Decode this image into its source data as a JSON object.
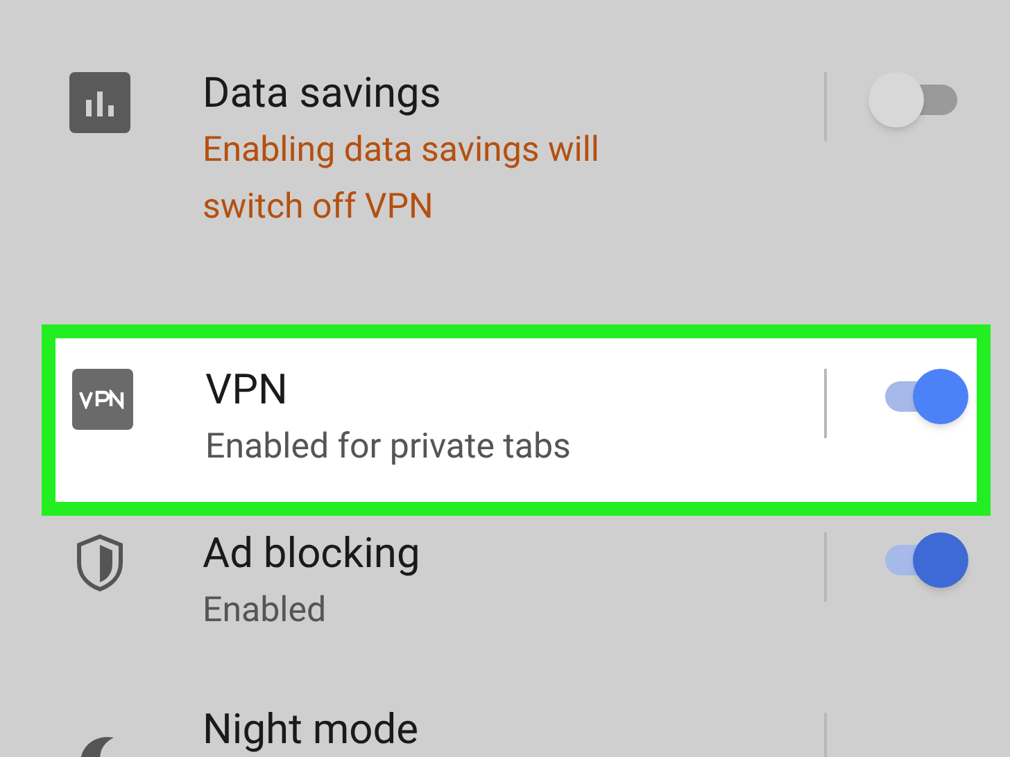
{
  "settings": [
    {
      "title": "Data savings",
      "subtitle": "Enabling data savings will switch off VPN",
      "warning": true,
      "highlighted": false,
      "on": false
    },
    {
      "title": "VPN",
      "subtitle": "Enabled for private tabs",
      "warning": false,
      "highlighted": true,
      "on": true
    },
    {
      "title": "Ad blocking",
      "subtitle": "Enabled",
      "warning": false,
      "highlighted": false,
      "on": true
    },
    {
      "title": "Night mode",
      "highlighted": false
    }
  ]
}
